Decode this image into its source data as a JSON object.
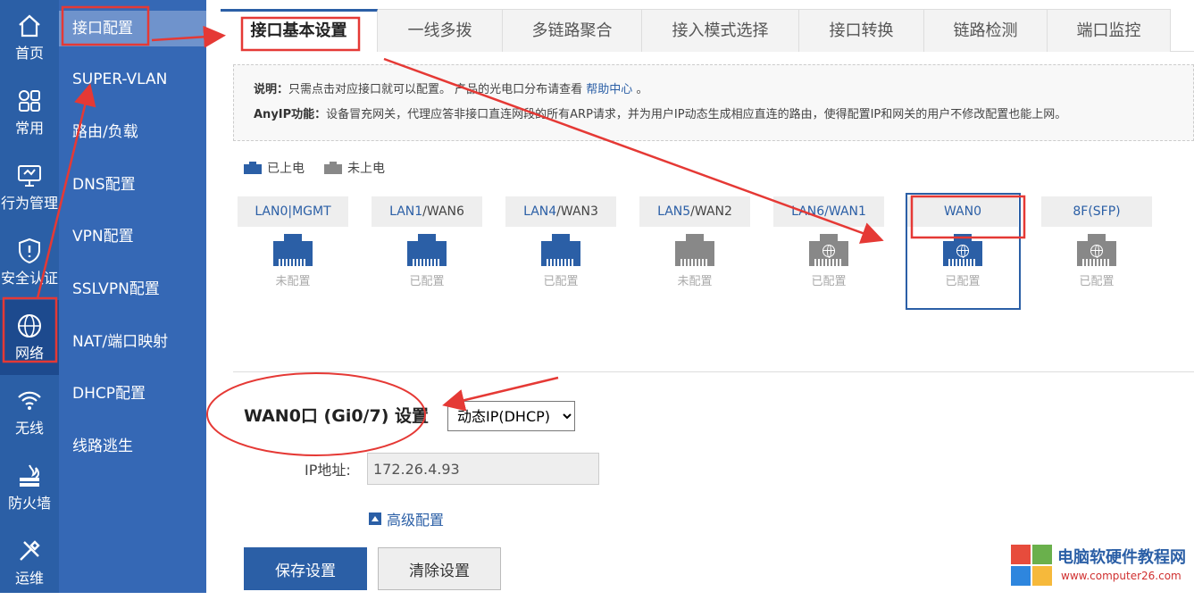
{
  "nav": {
    "items": [
      {
        "label": "首页",
        "icon": "home-icon"
      },
      {
        "label": "常用",
        "icon": "grid-icon"
      },
      {
        "label": "行为管理",
        "icon": "monitor-icon"
      },
      {
        "label": "安全认证",
        "icon": "shield-icon"
      },
      {
        "label": "网络",
        "icon": "network-globe-icon"
      },
      {
        "label": "无线",
        "icon": "wifi-icon"
      },
      {
        "label": "防火墙",
        "icon": "firewall-icon"
      },
      {
        "label": "运维",
        "icon": "tools-icon"
      }
    ]
  },
  "submenu": {
    "items": [
      "接口配置",
      "SUPER-VLAN",
      "路由/负载",
      "DNS配置",
      "VPN配置",
      "SSLVPN配置",
      "NAT/端口映射",
      "DHCP配置",
      "线路逃生"
    ]
  },
  "tabs": [
    "接口基本设置",
    "一线多拨",
    "多链路聚合",
    "接入模式选择",
    "接口转换",
    "链路检测",
    "端口监控"
  ],
  "note": {
    "label1": "说明：",
    "text1": "只需点击对应接口就可以配置。 产品的光电口分布请查看",
    "link": "帮助中心",
    "tail": " 。",
    "label2": "AnyIP功能：",
    "text2": "设备冒充网关，代理应答非接口直连网段的所有ARP请求，并为用户IP动态生成相应直连的路由，使得配置IP和网关的用户不修改配置也能上网。"
  },
  "legend": {
    "on": "已上电",
    "off": "未上电"
  },
  "ports": [
    {
      "hi": "LAN0|MGMT",
      "lo": "",
      "status": "未配置",
      "color": "#2b5fa6",
      "globe": false
    },
    {
      "hi": "LAN1",
      "lo": "/WAN6",
      "status": "已配置",
      "color": "#2b5fa6",
      "globe": false
    },
    {
      "hi": "LAN4",
      "lo": "/WAN3",
      "status": "已配置",
      "color": "#2b5fa6",
      "globe": false
    },
    {
      "hi": "LAN5",
      "lo": "/WAN2",
      "status": "未配置",
      "color": "#888888",
      "globe": false
    },
    {
      "hi": "LAN6/WAN1",
      "lo": "",
      "status": "已配置",
      "color": "#888888",
      "globe": true
    },
    {
      "hi": "WAN0",
      "lo": "",
      "status": "已配置",
      "color": "#2b5fa6",
      "globe": true
    },
    {
      "hi": "8F(SFP)",
      "lo": "",
      "status": "已配置",
      "color": "#888888",
      "globe": true
    }
  ],
  "wan": {
    "title": "WAN0口 (Gi0/7) 设置",
    "mode": "动态IP(DHCP)",
    "ip_label": "IP地址:",
    "ip_value": "172.26.4.93",
    "advanced": "高级配置",
    "save": "保存设置",
    "clear": "清除设置"
  },
  "watermark": {
    "title": "电脑软硬件教程网",
    "url": "www.computer26.com"
  },
  "colors": {
    "nav_dark": "#2b5fa6",
    "submenu": "#3568b5",
    "accent": "#2b5fa6",
    "annotation": "#e53935"
  }
}
